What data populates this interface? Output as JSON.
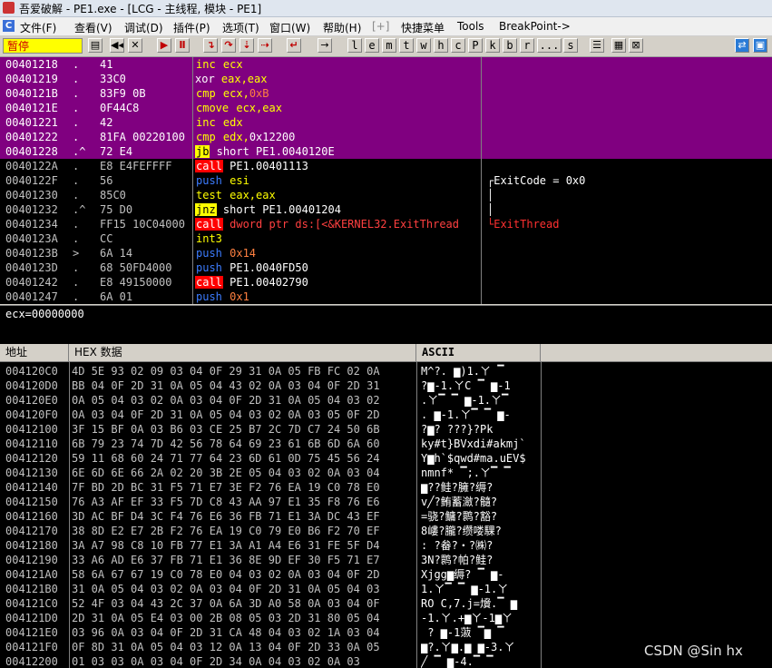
{
  "window": {
    "title": "吾爱破解 - PE1.exe - [LCG - 主线程, 模块 - PE1]"
  },
  "menu": [
    "文件(F)",
    "查看(V)",
    "调试(D)",
    "插件(P)",
    "选项(T)",
    "窗口(W)",
    "帮助(H)",
    "[+]",
    "快捷菜单",
    "Tools",
    "BreakPoint->"
  ],
  "toolbar": {
    "status": "暂停",
    "letters": [
      "l",
      "e",
      "m",
      "t",
      "w",
      "h",
      "c",
      "P",
      "k",
      "b",
      "r",
      "...",
      "s"
    ]
  },
  "disasm": [
    {
      "addr": "00401218",
      "mark": ".",
      "hex": "41",
      "asm": [
        [
          "inc",
          "inc"
        ],
        [
          "reg",
          " ecx"
        ]
      ],
      "cmt": "",
      "sel": true
    },
    {
      "addr": "00401219",
      "mark": ".",
      "hex": "33C0",
      "asm": [
        [
          "plain",
          "xor"
        ],
        [
          "reg",
          " eax,eax"
        ]
      ],
      "cmt": "",
      "sel": true
    },
    {
      "addr": "0040121B",
      "mark": ".",
      "hex": "83F9 0B",
      "asm": [
        [
          "cmp",
          "cmp"
        ],
        [
          "reg",
          " ecx,"
        ],
        [
          "num",
          "0xB"
        ]
      ],
      "cmt": "",
      "sel": true
    },
    {
      "addr": "0040121E",
      "mark": ".",
      "hex": "0F44C8",
      "asm": [
        [
          "cmp",
          "cmove"
        ],
        [
          "reg",
          " ecx,eax"
        ]
      ],
      "cmt": "",
      "sel": true
    },
    {
      "addr": "00401221",
      "mark": ".",
      "hex": "42",
      "asm": [
        [
          "inc",
          "inc"
        ],
        [
          "reg",
          " edx"
        ]
      ],
      "cmt": "",
      "sel": true
    },
    {
      "addr": "00401222",
      "mark": ".",
      "hex": "81FA 00220100",
      "asm": [
        [
          "cmp",
          "cmp"
        ],
        [
          "reg",
          " edx,"
        ],
        [
          "plain",
          "0x12200"
        ]
      ],
      "cmt": "",
      "sel": true
    },
    {
      "addr": "00401228",
      "mark": ".^",
      "hex": "72 E4",
      "asm": [
        [
          "jcc",
          "jb"
        ],
        [
          "plain",
          " short PE1.0040120E"
        ]
      ],
      "cmt": "",
      "sel": true
    },
    {
      "addr": "0040122A",
      "mark": ".",
      "hex": "E8 E4FEFFFF",
      "asm": [
        [
          "call",
          "call"
        ],
        [
          "plain",
          " PE1.00401113"
        ]
      ],
      "cmt": "",
      "sel": false
    },
    {
      "addr": "0040122F",
      "mark": ".",
      "hex": "56",
      "asm": [
        [
          "push",
          "push"
        ],
        [
          "reg",
          " esi"
        ]
      ],
      "cmt": "┌ExitCode = 0x0",
      "sel": false
    },
    {
      "addr": "00401230",
      "mark": ".",
      "hex": "85C0",
      "asm": [
        [
          "cmp",
          "test"
        ],
        [
          "reg",
          " eax,eax"
        ]
      ],
      "cmt": "│",
      "sel": false
    },
    {
      "addr": "00401232",
      "mark": ".^",
      "hex": "75 D0",
      "asm": [
        [
          "jcc",
          "jnz"
        ],
        [
          "plain",
          " short PE1.00401204"
        ]
      ],
      "cmt": "│",
      "sel": false
    },
    {
      "addr": "00401234",
      "mark": ".",
      "hex": "FF15 10C04000",
      "asm": [
        [
          "call",
          "call"
        ],
        [
          "kw",
          " dword ptr ds:[<&KERNEL32.ExitThread"
        ]
      ],
      "cmt": "└ExitThread",
      "sel": false
    },
    {
      "addr": "0040123A",
      "mark": ".",
      "hex": "CC",
      "asm": [
        [
          "int",
          "int3"
        ]
      ],
      "cmt": "",
      "sel": false
    },
    {
      "addr": "0040123B",
      "mark": ">",
      "hex": "6A 14",
      "asm": [
        [
          "push",
          "push"
        ],
        [
          "num",
          " 0x14"
        ]
      ],
      "cmt": "",
      "sel": false
    },
    {
      "addr": "0040123D",
      "mark": ".",
      "hex": "68 50FD4000",
      "asm": [
        [
          "push",
          "push"
        ],
        [
          "plain",
          " PE1.0040FD50"
        ]
      ],
      "cmt": "",
      "sel": false
    },
    {
      "addr": "00401242",
      "mark": ".",
      "hex": "E8 49150000",
      "asm": [
        [
          "call",
          "call"
        ],
        [
          "plain",
          " PE1.00402790"
        ]
      ],
      "cmt": "",
      "sel": false
    },
    {
      "addr": "00401247",
      "mark": ".",
      "hex": "6A 01",
      "asm": [
        [
          "push",
          "push"
        ],
        [
          "num",
          " 0x1"
        ]
      ],
      "cmt": "",
      "sel": false
    }
  ],
  "info": "ecx=00000000",
  "dump_header": {
    "addr": "地址",
    "hex": "HEX 数据",
    "ascii": "ASCII"
  },
  "dump": [
    {
      "addr": "004120C0",
      "hex": "4D 5E 93 02 09 03 04 0F 29 31 0A 05 FB FC 02 0A",
      "ascii": "M^?. ▆)1.ㄚ ▔"
    },
    {
      "addr": "004120D0",
      "hex": "BB 04 0F 2D 31 0A 05 04 43 02 0A 03 04 0F 2D 31",
      "ascii": "?▆-1.ㄚC ▔ ▆-1"
    },
    {
      "addr": "004120E0",
      "hex": "0A 05 04 03 02 0A 03 04 0F 2D 31 0A 05 04 03 02",
      "ascii": ".ㄚ▔ ▔ ▆-1.ㄚ▔"
    },
    {
      "addr": "004120F0",
      "hex": "0A 03 04 0F 2D 31 0A 05 04 03 02 0A 03 05 0F 2D",
      "ascii": ". ▆-1.ㄚ▔ ▔ ▆-"
    },
    {
      "addr": "00412100",
      "hex": "3F 15 BF 0A 03 B6 03 CE 25 B7 2C 7D C7 24 50 6B",
      "ascii": "?▆? ???}?Pk"
    },
    {
      "addr": "00412110",
      "hex": "6B 79 23 74 7D 42 56 78 64 69 23 61 6B 6D 6A 60",
      "ascii": "ky#t}BVxdi#akmj`"
    },
    {
      "addr": "00412120",
      "hex": "59 11 68 60 24 71 77 64 23 6D 61 0D 75 45 56 24",
      "ascii": "Y▆h`$qwd#ma.uEV$"
    },
    {
      "addr": "00412130",
      "hex": "6E 6D 6E 66 2A 02 20 3B 2E 05 04 03 02 0A 03 04",
      "ascii": "nmnf* ▔;.ㄚ▔ ▔"
    },
    {
      "addr": "00412140",
      "hex": "7F BD 2D BC 31 F5 71 E7 3E F2 76 EA 19 C0 78 E0",
      "ascii": "▆??鲑?臃?缛?"
    },
    {
      "addr": "00412150",
      "hex": "76 A3 AF EF 33 F5 7D C8 43 AA 97 E1 35 F8 76 E6",
      "ascii": "v╱?鲔蓄瀲?髓?"
    },
    {
      "addr": "00412160",
      "hex": "3D AC BF D4 3C F4 76 E6 36 FB 71 E1 3A DC 43 EF",
      "ascii": "=骁?鳙?鹮?豁?"
    },
    {
      "addr": "00412170",
      "hex": "38 8D E2 E7 2B F2 76 EA 19 C0 79 E0 B6 F2 70 EF",
      "ascii": "8嶁?朧?缵喽騍?"
    },
    {
      "addr": "00412180",
      "hex": "3A A7 98 C8 10 FB 77 E1 3A A1 A4 E6 31 FE 5F D4",
      "ascii": ": ?畚?・?㈱?"
    },
    {
      "addr": "00412190",
      "hex": "33 A6 AD E6 37 FB 71 E1 36 8E 9D EF 30 F5 71 E7",
      "ascii": "3Ν?鹮?帕?鲑?"
    },
    {
      "addr": "004121A0",
      "hex": "58 6A 67 67 19 C0 78 E0 04 03 02 0A 03 04 0F 2D",
      "ascii": "Xjgg▆缛? ▔ ▆-"
    },
    {
      "addr": "004121B0",
      "hex": "31 0A 05 04 03 02 0A 03 04 0F 2D 31 0A 05 04 03",
      "ascii": "1.ㄚ▔ ▔ ▆-1.ㄚ"
    },
    {
      "addr": "004121C0",
      "hex": "52 4F 03 04 43 2C 37 0A 6A 3D A0 58 0A 03 04 0F",
      "ascii": "RO C,7.j=燲.▔ ▆"
    },
    {
      "addr": "004121D0",
      "hex": "2D 31 0A 05 E4 03 00 2B 08 05 03 2D 31 80 05 04",
      "ascii": "-1.ㄚ.+▆ㄚ-1▆ㄚ"
    },
    {
      "addr": "004121E0",
      "hex": "03 96 0A 03 04 0F 2D 31 CA 48 04 03 02 1A 03 04",
      "ascii": " ? ▆-1蔋 ▔▆ ▔"
    },
    {
      "addr": "004121F0",
      "hex": "0F 8D 31 0A 05 04 03 12 0A 13 04 0F 2D 33 0A 05",
      "ascii": "▆?.ㄚ▆.▆ ▆-3.ㄚ"
    },
    {
      "addr": "00412200",
      "hex": "01 03 03 0A 03 04 0F 2D 34 0A 04 03 02 0A 03 ",
      "ascii": "╱ ▔ ▆-4.▔ ▔"
    }
  ],
  "watermark": "CSDN @Sin hx"
}
